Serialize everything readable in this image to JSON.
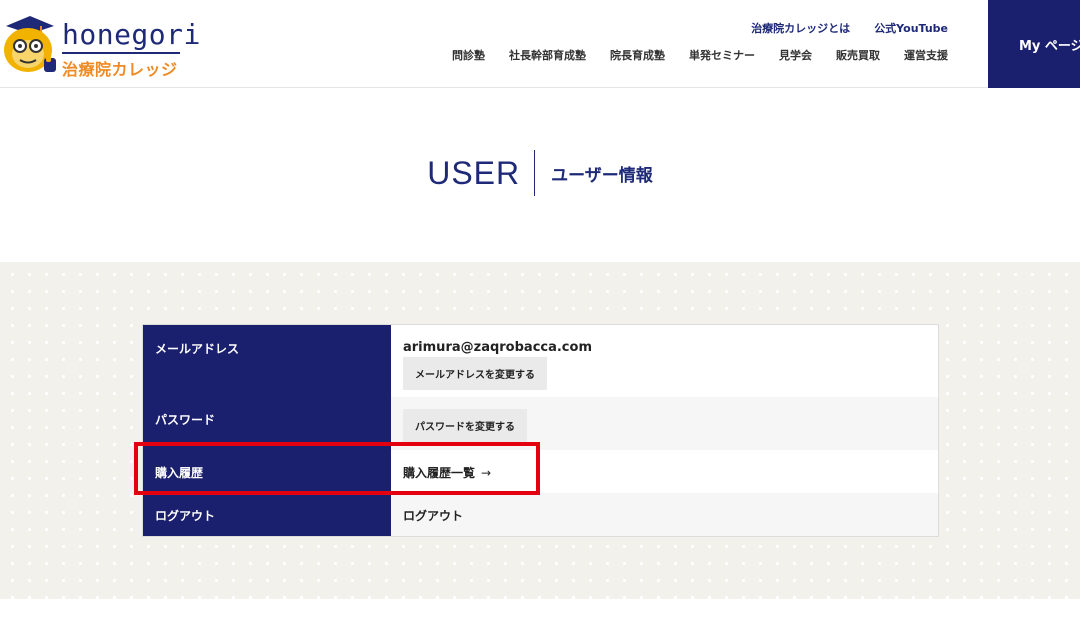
{
  "header": {
    "logo": {
      "text_en": "honegori",
      "text_ja": "治療院カレッジ"
    },
    "util_nav": [
      "治療院カレッジとは",
      "公式YouTube"
    ],
    "main_nav": [
      "問診塾",
      "社長幹部育成塾",
      "院長育成塾",
      "単発セミナー",
      "見学会",
      "販売買取",
      "運営支援"
    ],
    "mypage_label": "My ページ"
  },
  "title": {
    "en": "USER",
    "ja": "ユーザー情報"
  },
  "table": {
    "email": {
      "label": "メールアドレス",
      "value": "arimura@zaqrobacca.com",
      "button": "メールアドレスを変更する"
    },
    "password": {
      "label": "パスワード",
      "button": "パスワードを変更する"
    },
    "history": {
      "label": "購入履歴",
      "link": "購入履歴一覧",
      "arrow": "→"
    },
    "logout": {
      "label": "ログアウト",
      "link": "ログアウト"
    }
  },
  "colors": {
    "navy": "#1a1f6e",
    "brand_blue": "#1e2a78",
    "orange": "#f08a24",
    "highlight_red": "#e3000f",
    "band_bg": "#f3f1eb"
  }
}
